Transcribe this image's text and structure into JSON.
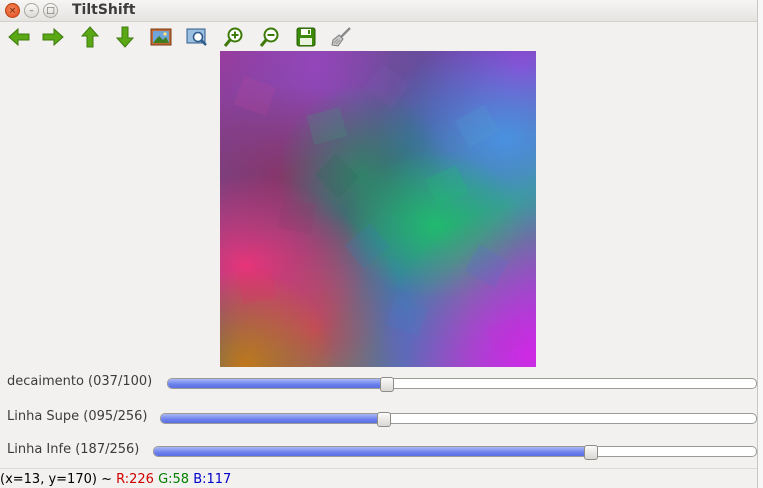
{
  "window": {
    "title": "TiltShift",
    "close_glyph": "×",
    "minimize_glyph": "–",
    "maximize_glyph": "□"
  },
  "toolbar": {
    "buttons": [
      {
        "icon": "arrow-left-icon",
        "color": "#4e9a06"
      },
      {
        "icon": "arrow-right-icon",
        "color": "#4e9a06"
      },
      {
        "icon": "arrow-up-icon",
        "color": "#4e9a06"
      },
      {
        "icon": "arrow-down-icon",
        "color": "#4e9a06"
      },
      {
        "icon": "image-icon",
        "color": "#b5552a"
      },
      {
        "icon": "zoom-fit-icon",
        "color": "#2e5b8a"
      },
      {
        "icon": "zoom-in-icon",
        "color": "#4e9a06"
      },
      {
        "icon": "zoom-out-icon",
        "color": "#4e9a06"
      },
      {
        "icon": "save-icon",
        "color": "#4e9a06"
      },
      {
        "icon": "clear-brush-icon",
        "color": "#888888"
      }
    ]
  },
  "trackbars": [
    {
      "label": "decaimento (037/100)",
      "value": 37,
      "max": 100
    },
    {
      "label": "Linha Supe (095/256)",
      "value": 95,
      "max": 256
    },
    {
      "label": "Linha Infe (187/256)",
      "value": 187,
      "max": 256
    }
  ],
  "status": {
    "coords": "(x=13, y=170) ~ ",
    "r": "R:226",
    "g": "G:58",
    "b": "B:117"
  },
  "colors": {
    "accent_fill": "#6b80ec",
    "status_r": "#d00000",
    "status_g": "#008000",
    "status_b": "#0000c8"
  }
}
